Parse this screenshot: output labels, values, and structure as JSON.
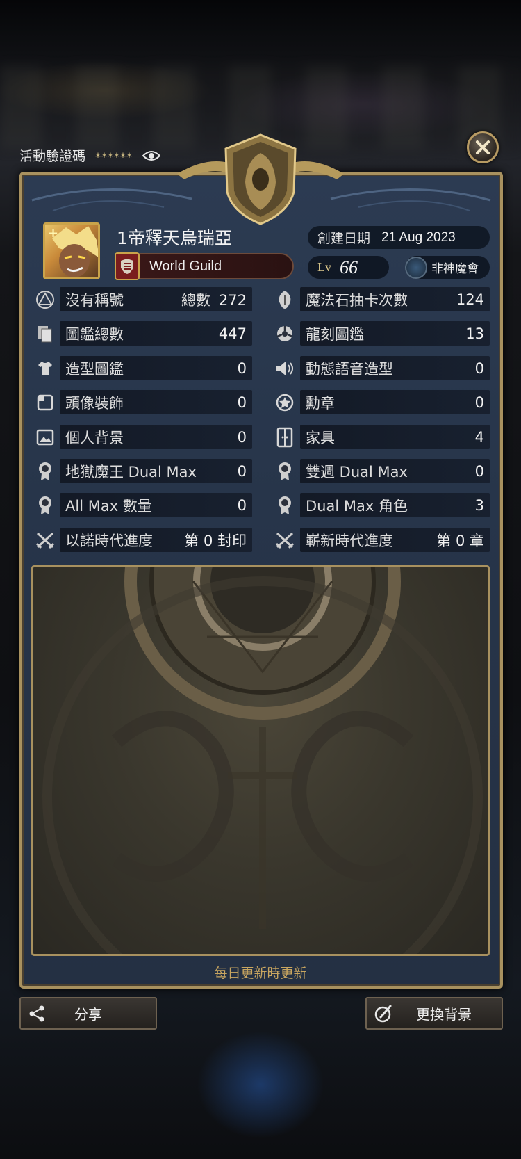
{
  "verify": {
    "label": "活動驗證碼",
    "masked_code": "******"
  },
  "player": {
    "name": "1帝釋天烏瑞亞",
    "guild": "World Guild",
    "created_label": "創建日期",
    "created_date": "21 Aug 2023",
    "level_label": "Lv",
    "level": "66",
    "rank_label": "非神魔會"
  },
  "stats_left": [
    {
      "icon": "title-icon",
      "label": "沒有稱號",
      "sub": "總數",
      "value": "272"
    },
    {
      "icon": "cards-icon",
      "label": "圖鑑總數",
      "value": "447"
    },
    {
      "icon": "shirt-icon",
      "label": "造型圖鑑",
      "value": "0"
    },
    {
      "icon": "frame-icon",
      "label": "頭像裝飾",
      "value": "0"
    },
    {
      "icon": "picture-icon",
      "label": "個人背景",
      "value": "0"
    },
    {
      "icon": "medal-icon",
      "label": "地獄魔王 Dual Max",
      "value": "0"
    },
    {
      "icon": "medal-icon",
      "label": "All Max 數量",
      "value": "0"
    },
    {
      "icon": "swords-icon",
      "label": "以諾時代進度",
      "value": "第 0 封印"
    }
  ],
  "stats_right": [
    {
      "icon": "stone-icon",
      "label": "魔法石抽卡次數",
      "value": "124"
    },
    {
      "icon": "dragon-icon",
      "label": "龍刻圖鑑",
      "value": "13"
    },
    {
      "icon": "speaker-icon",
      "label": "動態語音造型",
      "value": "0"
    },
    {
      "icon": "badge-icon",
      "label": "勳章",
      "value": "0"
    },
    {
      "icon": "furniture-icon",
      "label": "家具",
      "value": "4"
    },
    {
      "icon": "medal-icon",
      "label": "雙週 Dual Max",
      "value": "0"
    },
    {
      "icon": "medal-icon",
      "label": "Dual Max 角色",
      "value": "3"
    },
    {
      "icon": "swords-icon",
      "label": "嶄新時代進度",
      "value": "第 0 章"
    }
  ],
  "footer": {
    "daily_note": "每日更新時更新",
    "share_label": "分享",
    "change_bg_label": "更換背景"
  },
  "colors": {
    "gold": "#a8915f",
    "panel": "#2c3b52",
    "accent_text": "#c9a660"
  }
}
